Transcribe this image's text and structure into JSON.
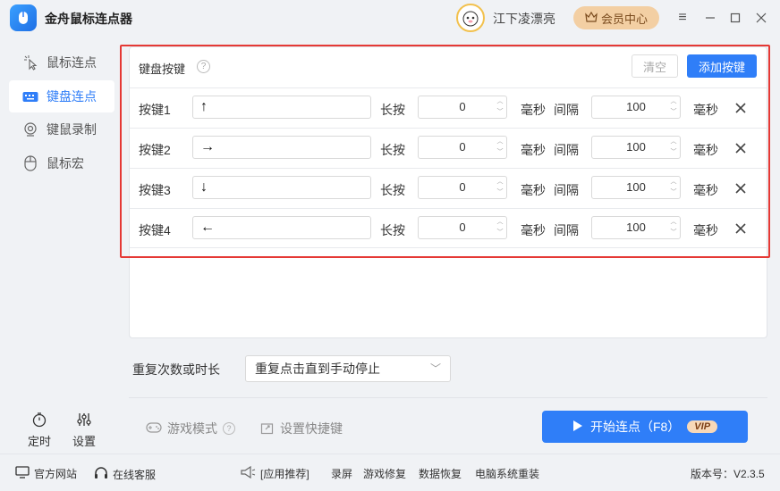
{
  "app": {
    "title": "金舟鼠标连点器",
    "user_name": "江下凌漂亮",
    "vip_center": "会员中心"
  },
  "sidebar": {
    "items": [
      {
        "label": "鼠标连点",
        "icon": "click-icon",
        "active": false
      },
      {
        "label": "键盘连点",
        "icon": "keyboard-icon",
        "active": true
      },
      {
        "label": "键鼠录制",
        "icon": "record-icon",
        "active": false
      },
      {
        "label": "鼠标宏",
        "icon": "mouse-icon",
        "active": false
      }
    ],
    "bottom": [
      {
        "label": "定时",
        "icon": "timer-icon"
      },
      {
        "label": "设置",
        "icon": "settings-icon"
      }
    ]
  },
  "panel": {
    "title": "键盘按键",
    "clear_label": "清空",
    "add_label": "添加按键",
    "press_label": "长按",
    "interval_label": "间隔",
    "unit": "毫秒",
    "rows": [
      {
        "name": "按键1",
        "key": "↑",
        "press": "0",
        "interval": "100"
      },
      {
        "name": "按键2",
        "key": "→",
        "press": "0",
        "interval": "100"
      },
      {
        "name": "按键3",
        "key": "↓",
        "press": "0",
        "interval": "100"
      },
      {
        "name": "按键4",
        "key": "←",
        "press": "0",
        "interval": "100"
      }
    ]
  },
  "repeat": {
    "label": "重复次数或时长",
    "value": "重复点击直到手动停止"
  },
  "actions": {
    "game_mode": "游戏模式",
    "hotkey": "设置快捷键",
    "start": "开始连点（F8）",
    "vip": "VIP"
  },
  "footer": {
    "website": "官方网站",
    "service": "在线客服",
    "recommend": "[应用推荐]",
    "links": [
      "录屏",
      "游戏修复",
      "数据恢复",
      "电脑系统重装"
    ],
    "version": "版本号：V2.3.5"
  },
  "colors": {
    "accent": "#2f7ef8",
    "highlight_frame": "#e53935",
    "vip_bg": "#f3cfa3"
  }
}
